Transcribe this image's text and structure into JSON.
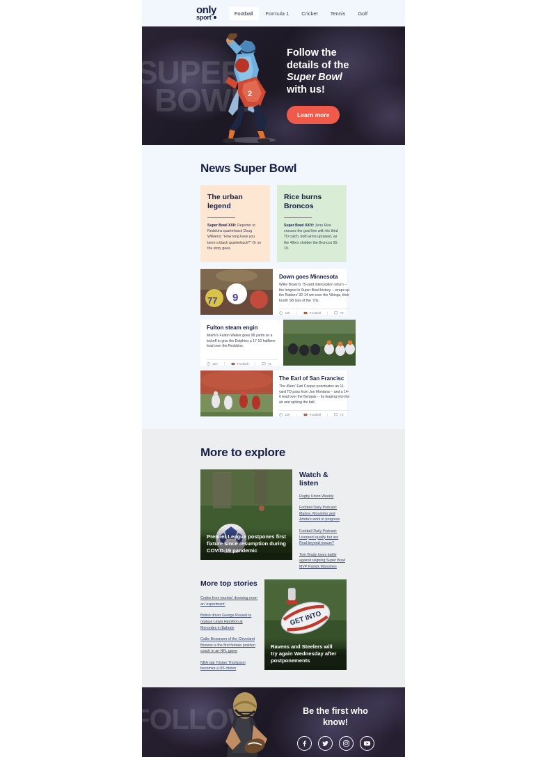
{
  "header": {
    "logo": {
      "line1": "only",
      "line2": "sport"
    },
    "nav": [
      {
        "label": "Football",
        "active": true
      },
      {
        "label": "Formula 1",
        "active": false
      },
      {
        "label": "Cricket",
        "active": false
      },
      {
        "label": "Tennis",
        "active": false
      },
      {
        "label": "Golf",
        "active": false
      }
    ]
  },
  "hero": {
    "watermark_line1": "SUPER",
    "watermark_line2": "BOWL",
    "heading_line1": "Follow the",
    "heading_line2": "details of the",
    "heading_em": "Super Bowl",
    "heading_line3": "with us!",
    "button": "Learn more",
    "button_color": "#ef5a4a"
  },
  "news": {
    "title": "News Super Bowl",
    "cards": [
      {
        "title": "The urban legend",
        "lead": "Super Bowl XXII:",
        "body": " Reporter to Redskins quarterback Doug Williams: \"How long have you been a black quarterback?\" Or so the story goes.",
        "color": "#fde6d2"
      },
      {
        "title": "Rice burns Broncos",
        "lead": "Super Bowl XXIV:",
        "body": " Jerry Rice crosses the goal line with his third TD catch, both arms upraised, as the 49ers clobber the Broncos 55-10.",
        "color": "#d9ecd5"
      }
    ],
    "articles": [
      {
        "title": "Down goes Minnesota",
        "body": "Willie Brown's 75-yard interception return -- the longest in Super Bowl history -- wraps up the Raiders' 32-14 win over the Vikings, their fourth SB loss of the '70s.",
        "time": "12h",
        "category": "Football",
        "comments": "72",
        "image_side": "left"
      },
      {
        "title": "Fulton steam engin",
        "body": "Miami's Fulton Walker goes 98 yards on a kickoff to give the Dolphins a 17-10 halftime lead over the Redskins.",
        "time": "12h",
        "category": "Football",
        "comments": "72",
        "image_side": "right"
      },
      {
        "title": "The Earl of San Francisc",
        "body": "The 49ers' Earl Cooper punctuates an 11-yard TD pass from Joe Montana -- and a 14-0 lead over the Bengals -- by leaping into the air and spiking the ball.",
        "time": "12h",
        "category": "Football",
        "comments": "72",
        "image_side": "left"
      }
    ]
  },
  "explore": {
    "title": "More to explore",
    "feature_caption": "Premier League postpones first fixture since resumption during COVID-19 pandemic",
    "watch": {
      "title": "Watch & listen",
      "links": [
        "Rugby Union Weekly",
        "Football Daily Podcast: Marine, Mourinho and Arteta's work in progress",
        "Football Daily Podcast: Liverpool qualify but are Real beyond rescue?",
        "Tom Brady loses battle against reigning Super Bowl MVP Patrick Mahomes"
      ]
    },
    "top_stories": {
      "title": "More top stories",
      "links": [
        "Codes from tourists' dressing room an 'experiment'",
        "British driver George Russell to replace Lewis Hamilton at Mercedes in Bahrain",
        "Callie Brownson of the Cleveland Browns is the first female position coach in an NFL game",
        "NBA star Tristan Thompson becomes a US citizen"
      ]
    },
    "rugby_caption": "Ravens and Steelers will try again Wednesday after postponements"
  },
  "footer": {
    "watermark": "FOLLOW",
    "heading_line1": "Be the first who",
    "heading_line2": "know!",
    "socials": [
      "facebook-icon",
      "twitter-icon",
      "instagram-icon",
      "youtube-icon"
    ]
  }
}
